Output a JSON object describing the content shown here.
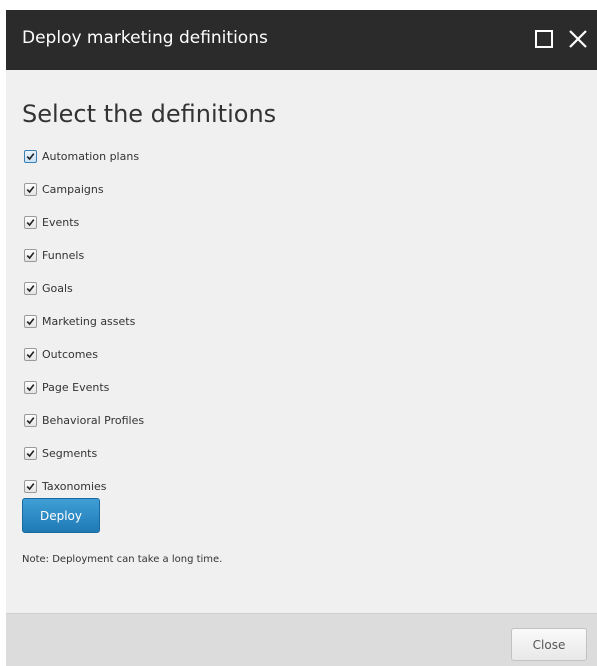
{
  "dialog": {
    "title": "Deploy marketing definitions",
    "maximize_icon": "maximize-icon",
    "close_icon": "close-icon"
  },
  "content": {
    "heading": "Select the definitions",
    "definitions": [
      {
        "label": "Automation plans",
        "checked": true
      },
      {
        "label": "Campaigns",
        "checked": true
      },
      {
        "label": "Events",
        "checked": true
      },
      {
        "label": "Funnels",
        "checked": true
      },
      {
        "label": "Goals",
        "checked": true
      },
      {
        "label": "Marketing assets",
        "checked": true
      },
      {
        "label": "Outcomes",
        "checked": true
      },
      {
        "label": "Page Events",
        "checked": true
      },
      {
        "label": "Behavioral Profiles",
        "checked": true
      },
      {
        "label": "Segments",
        "checked": true
      },
      {
        "label": "Taxonomies",
        "checked": true
      }
    ],
    "deploy_label": "Deploy",
    "note": "Note: Deployment can take a long time."
  },
  "footer": {
    "close_label": "Close"
  },
  "colors": {
    "titlebar": "#2b2b2b",
    "dialog_bg": "#f0f0f0",
    "footer_bg": "#dcdcdc",
    "accent": "#2a8ac6"
  }
}
